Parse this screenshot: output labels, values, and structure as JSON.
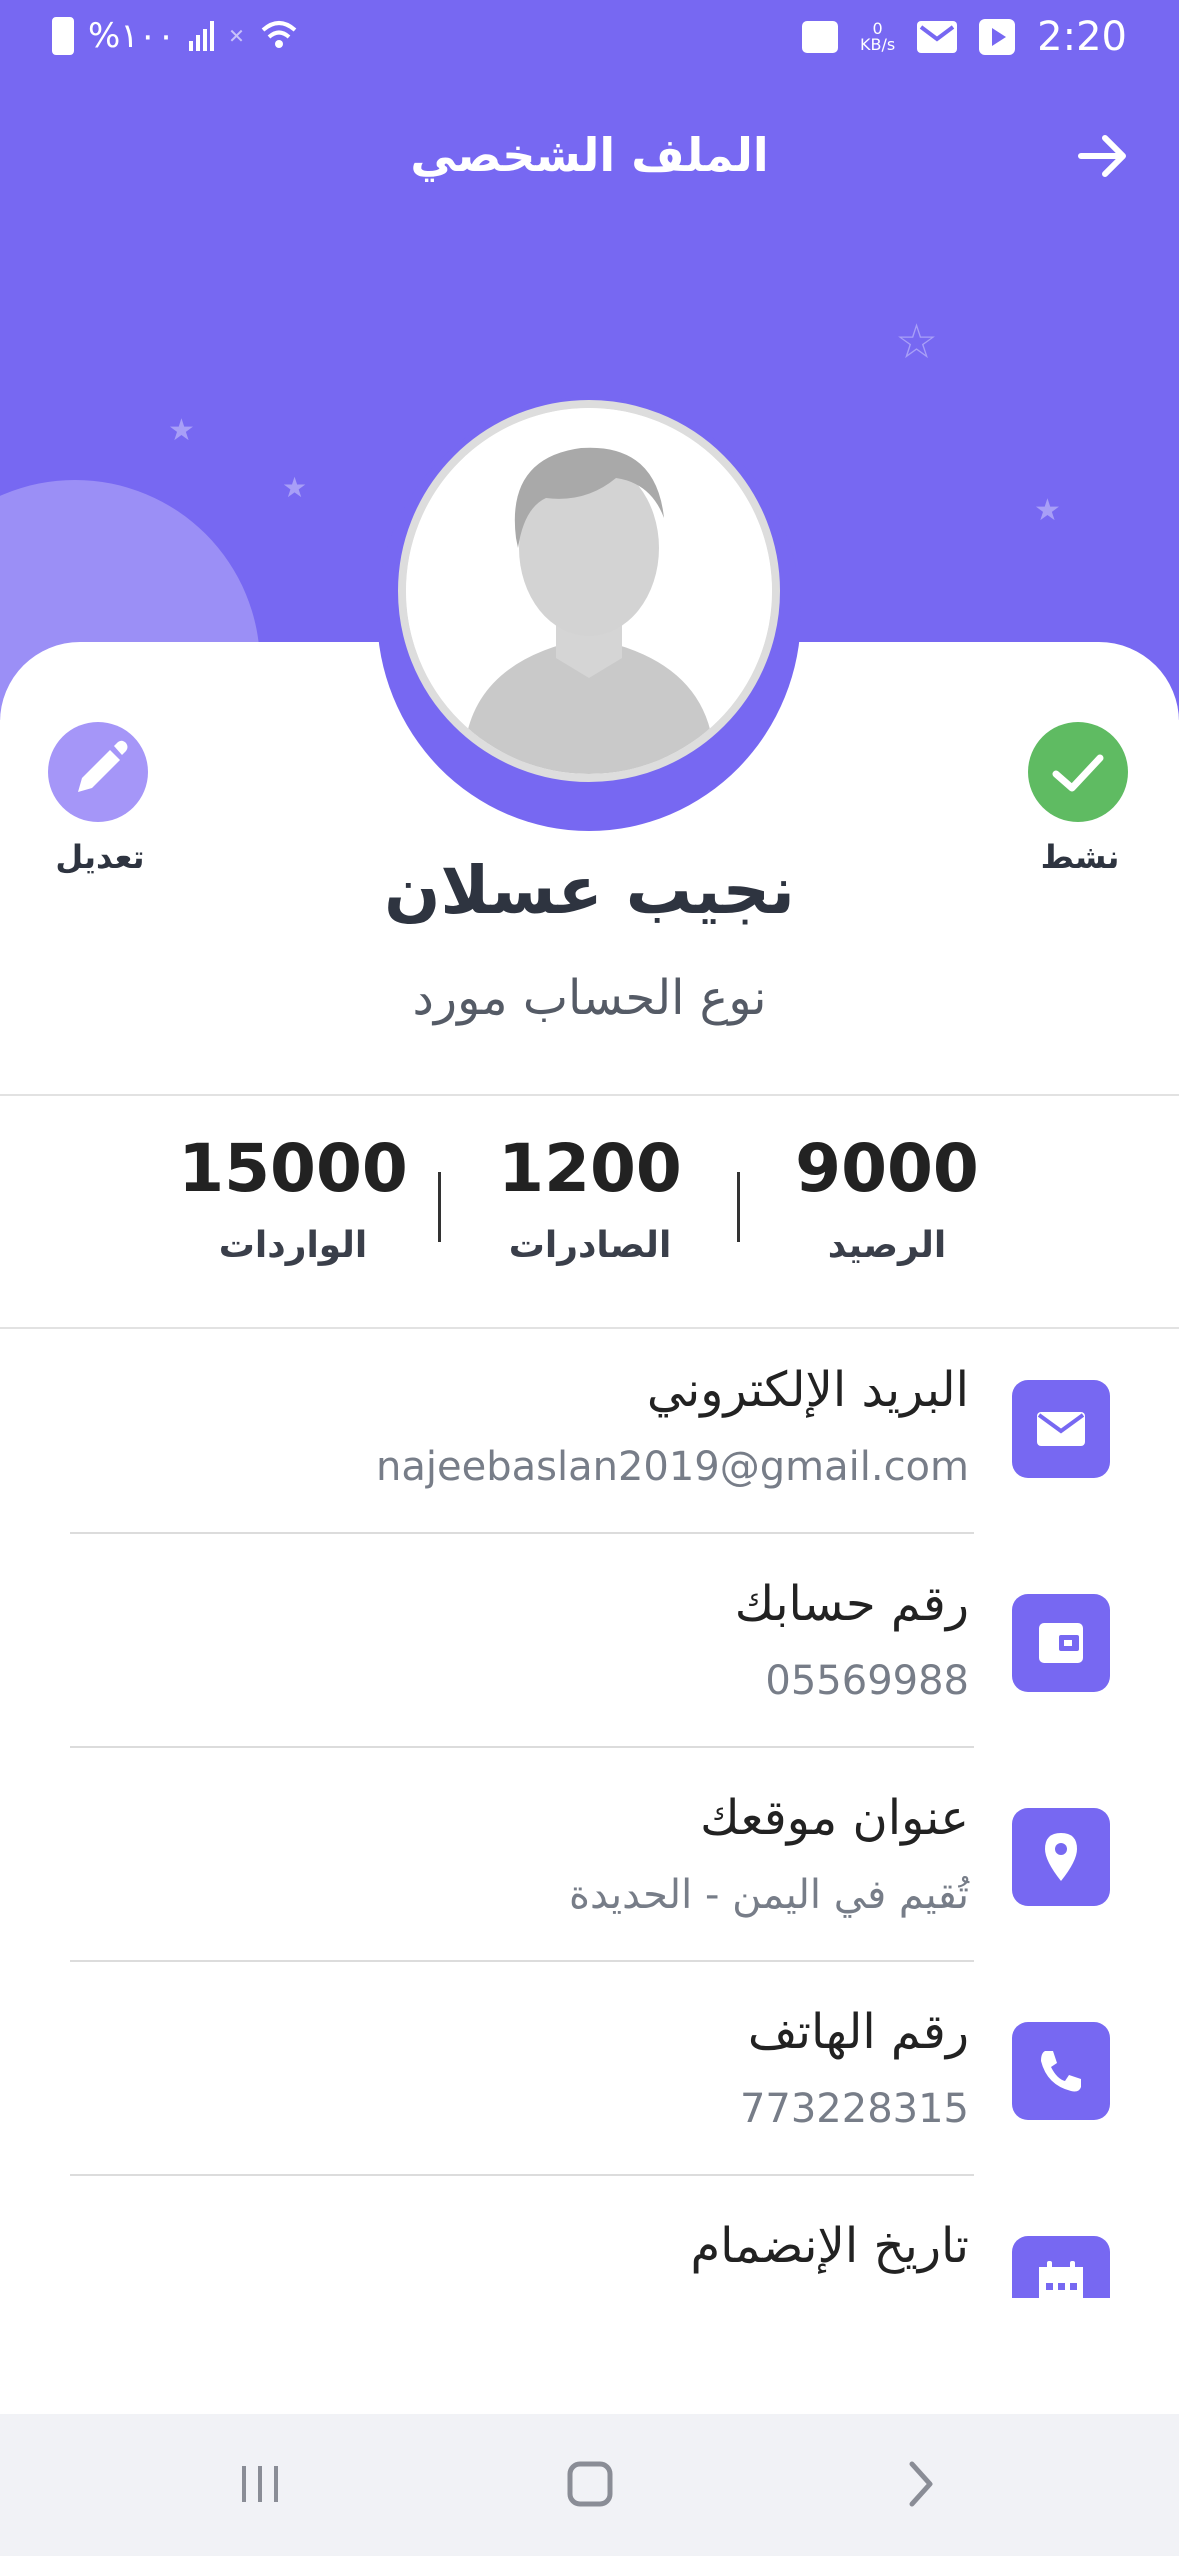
{
  "status_bar": {
    "battery_text": "%١٠٠",
    "time": "2:20",
    "net_speed": "0",
    "net_unit": "KB/s"
  },
  "header": {
    "title": "الملف الشخصي"
  },
  "profile": {
    "name": "نجيب عسلان",
    "account_type": "نوع الحساب مورد",
    "status_label": "نشط",
    "edit_label": "تعديل"
  },
  "stats": [
    {
      "value": "9000",
      "label": "الرصيد"
    },
    {
      "value": "1200",
      "label": "الصادرات"
    },
    {
      "value": "15000",
      "label": "الواردات"
    }
  ],
  "info": [
    {
      "title": "البريد الإلكتروني",
      "value": "najeebaslan2019@gmail.com",
      "icon": "mail-icon"
    },
    {
      "title": "رقم حسابك",
      "value": "05569988",
      "icon": "wallet-icon"
    },
    {
      "title": "عنوان موقعك",
      "value": "تُقيم في اليمن - الحديدة",
      "icon": "location-icon"
    },
    {
      "title": "رقم الهاتف",
      "value": "773228315",
      "icon": "phone-icon"
    },
    {
      "title": "تاريخ الإنضمام",
      "value": "",
      "icon": "calendar-icon"
    }
  ],
  "colors": {
    "accent": "#7768f2",
    "active_green": "#5fbb62",
    "edit_purple": "#a596f8",
    "text_dark": "#2e3440"
  }
}
